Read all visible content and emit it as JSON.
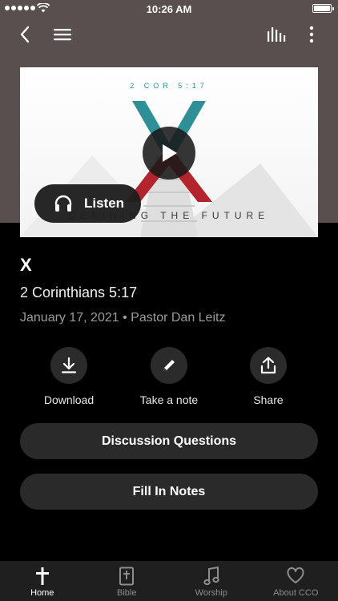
{
  "status_bar": {
    "time": "10:26 AM"
  },
  "artwork": {
    "scripture_ref": "2 COR 5:17",
    "tagline": "DEFINING THE FUTURE",
    "listen_label": "Listen"
  },
  "sermon": {
    "title": "X",
    "passage": "2 Corinthians 5:17",
    "date": "January 17, 2021",
    "separator": "•",
    "speaker": "Pastor Dan Leitz"
  },
  "actions": [
    {
      "label": "Download",
      "icon": "download-icon"
    },
    {
      "label": "Take a note",
      "icon": "pencil-icon"
    },
    {
      "label": "Share",
      "icon": "share-icon"
    }
  ],
  "buttons": {
    "discussion": "Discussion Questions",
    "fill_in_notes": "Fill In Notes"
  },
  "tabs": [
    {
      "label": "Home",
      "icon": "cross-icon",
      "active": true
    },
    {
      "label": "Bible",
      "icon": "bible-icon",
      "active": false
    },
    {
      "label": "Worship",
      "icon": "music-note-icon",
      "active": false
    },
    {
      "label": "About CCO",
      "icon": "heart-icon",
      "active": false
    }
  ],
  "colors": {
    "hero_background": "#5a4f4f",
    "page_background": "#000000",
    "pill_background": "#2a2a2a",
    "accent_teal": "#2e8f96",
    "accent_red": "#b3242c"
  }
}
